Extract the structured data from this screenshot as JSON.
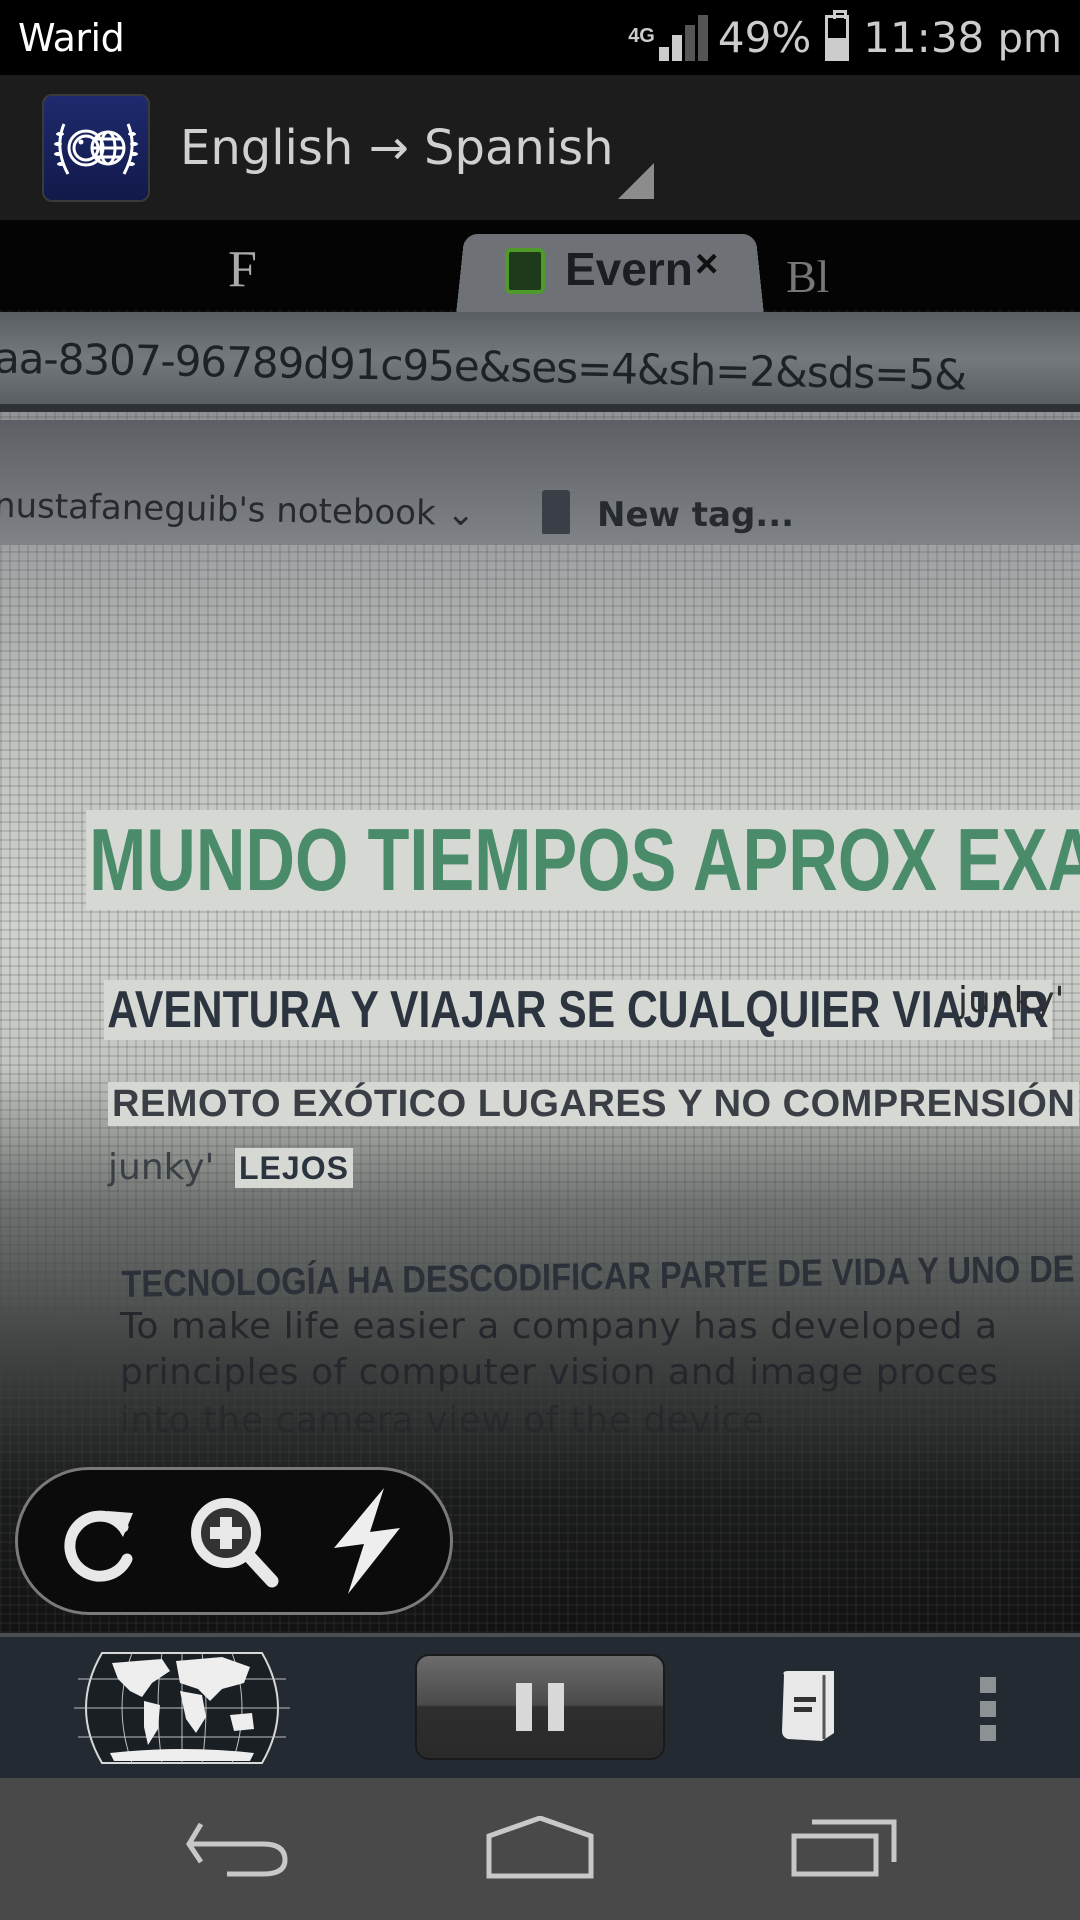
{
  "status_bar": {
    "carrier": "Warid",
    "network_type": "4G",
    "signal_bars_filled": 2,
    "signal_bars_total": 4,
    "battery_percent_label": "49%",
    "battery_level": 0.49,
    "time": "11:38",
    "ampm": "pm"
  },
  "app_bar": {
    "logo_icon": "camera-globe-laurel-icon",
    "language_pair": "English → Spanish",
    "dropdown_icon": "dropdown-corner-icon"
  },
  "camera_view": {
    "browser": {
      "tabs": [
        {
          "label": "F"
        },
        {
          "label": "Evern",
          "favicon": "evernote-icon",
          "close": "×",
          "active": true
        },
        {
          "label": "Bl"
        }
      ],
      "url": "aa-8307-96789d91c95e&ses=4&sh=2&sds=5&",
      "notebook": "nustafaneguib's notebook ⌄",
      "new_tag": "New tag..."
    },
    "translations": {
      "title": "MUNDO TIEMPOS APROX EXAMEN",
      "line2": "AVENTURA Y VIAJAR SE CUALQUIER VIAJAR",
      "line2_untranslated": "junky'",
      "line3": "REMOTO EXÓTICO LUGARES Y NO COMPRENSIÓN",
      "line4_untranslated": "junky'",
      "line4": "LEJOS",
      "line5": "TECNOLOGÍA HA DESCODIFICAR PARTE DE VIDA Y UNO DE"
    },
    "original_text": [
      "To make life easier a company has developed a",
      "principles of computer vision and image proces",
      "into the camera view of the device."
    ]
  },
  "camera_controls": {
    "buttons": [
      {
        "name": "refresh",
        "icon": "refresh-icon"
      },
      {
        "name": "zoom",
        "icon": "zoom-in-icon"
      },
      {
        "name": "flash",
        "icon": "flash-icon"
      }
    ]
  },
  "toolbar": {
    "buttons": [
      {
        "name": "languages",
        "icon": "world-map-icon"
      },
      {
        "name": "pause",
        "icon": "pause-icon"
      },
      {
        "name": "history",
        "icon": "book-icon"
      },
      {
        "name": "more",
        "icon": "overflow-menu-icon"
      }
    ]
  },
  "navbar": {
    "buttons": [
      {
        "name": "back",
        "icon": "back-icon"
      },
      {
        "name": "home",
        "icon": "home-icon"
      },
      {
        "name": "recent-apps",
        "icon": "recent-apps-icon"
      }
    ]
  }
}
